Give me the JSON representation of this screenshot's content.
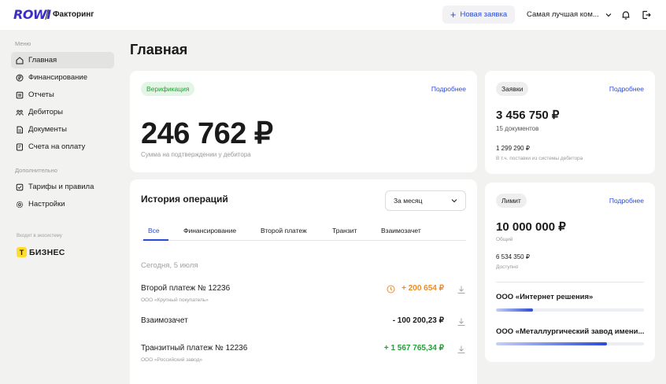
{
  "header": {
    "logo": "ROWI",
    "product": "Факторинг",
    "new_request": "Новая заявка",
    "company": "Самая лучшая ком..."
  },
  "sidebar": {
    "menu_title": "Меню",
    "items": [
      {
        "label": "Главная",
        "icon": "home-icon",
        "active": true
      },
      {
        "label": "Финансирование",
        "icon": "ruble-icon"
      },
      {
        "label": "Отчеты",
        "icon": "report-icon"
      },
      {
        "label": "Дебиторы",
        "icon": "debtors-icon"
      },
      {
        "label": "Документы",
        "icon": "document-icon"
      },
      {
        "label": "Счета на оплату",
        "icon": "invoice-icon"
      }
    ],
    "extra_title": "Дополнительно",
    "extra_items": [
      {
        "label": "Тарифы и правила",
        "icon": "tariff-icon"
      },
      {
        "label": "Настройки",
        "icon": "gear-icon"
      }
    ],
    "ecosystem_label": "Входит в экосистему",
    "partner_mark": "Т",
    "partner_name": "БИЗНЕС"
  },
  "main": {
    "title": "Главная",
    "verification": {
      "badge": "Верификация",
      "more": "Подробнее",
      "amount": "246 762 ₽",
      "caption": "Сумма на подтверждении у дебитора"
    },
    "history": {
      "title": "История операций",
      "period": "За месяц",
      "tabs": [
        "Все",
        "Финансирование",
        "Второй платеж",
        "Транзит",
        "Взаимозачет"
      ],
      "date": "Сегодня, 5 июля",
      "operations": [
        {
          "title": "Второй платеж № 12236",
          "sub": "ООО «Крупный покупатель»",
          "amount": "+ 200 654 ₽",
          "color": "#f08a24"
        },
        {
          "title": "Взаимозачет",
          "sub": "",
          "amount": "- 100 200,23 ₽",
          "color": "#1a1a1a"
        },
        {
          "title": "Транзитный платеж № 12236",
          "sub": "ООО «Российский завод»",
          "amount": "+ 1 567 765,34 ₽",
          "color": "#21a038"
        }
      ]
    },
    "requests": {
      "badge": "Заявки",
      "more": "Подробнее",
      "amount": "3 456 750 ₽",
      "count": "15 документов",
      "supplies_amount": "1 299 290 ₽",
      "supplies_caption": "В т.ч. поставки из системы дебитора"
    },
    "limit": {
      "badge": "Лимит",
      "more": "Подробнее",
      "total": "10 000 000 ₽",
      "total_caption": "Общий",
      "available": "6 534 350 ₽",
      "available_caption": "Доступно",
      "debtors": [
        {
          "name": "ООО «Интернет решения»",
          "fill": 0.25
        },
        {
          "name": "ООО «Металлургический завод имени...»",
          "fill": 0.75
        }
      ]
    }
  },
  "colors": {
    "accent": "#2a4bd6",
    "brand": "#3d2fc4",
    "verification_bg": "#e3f5e5",
    "verification_text": "#21a038",
    "positive": "#21a038",
    "pending": "#f08a24"
  }
}
